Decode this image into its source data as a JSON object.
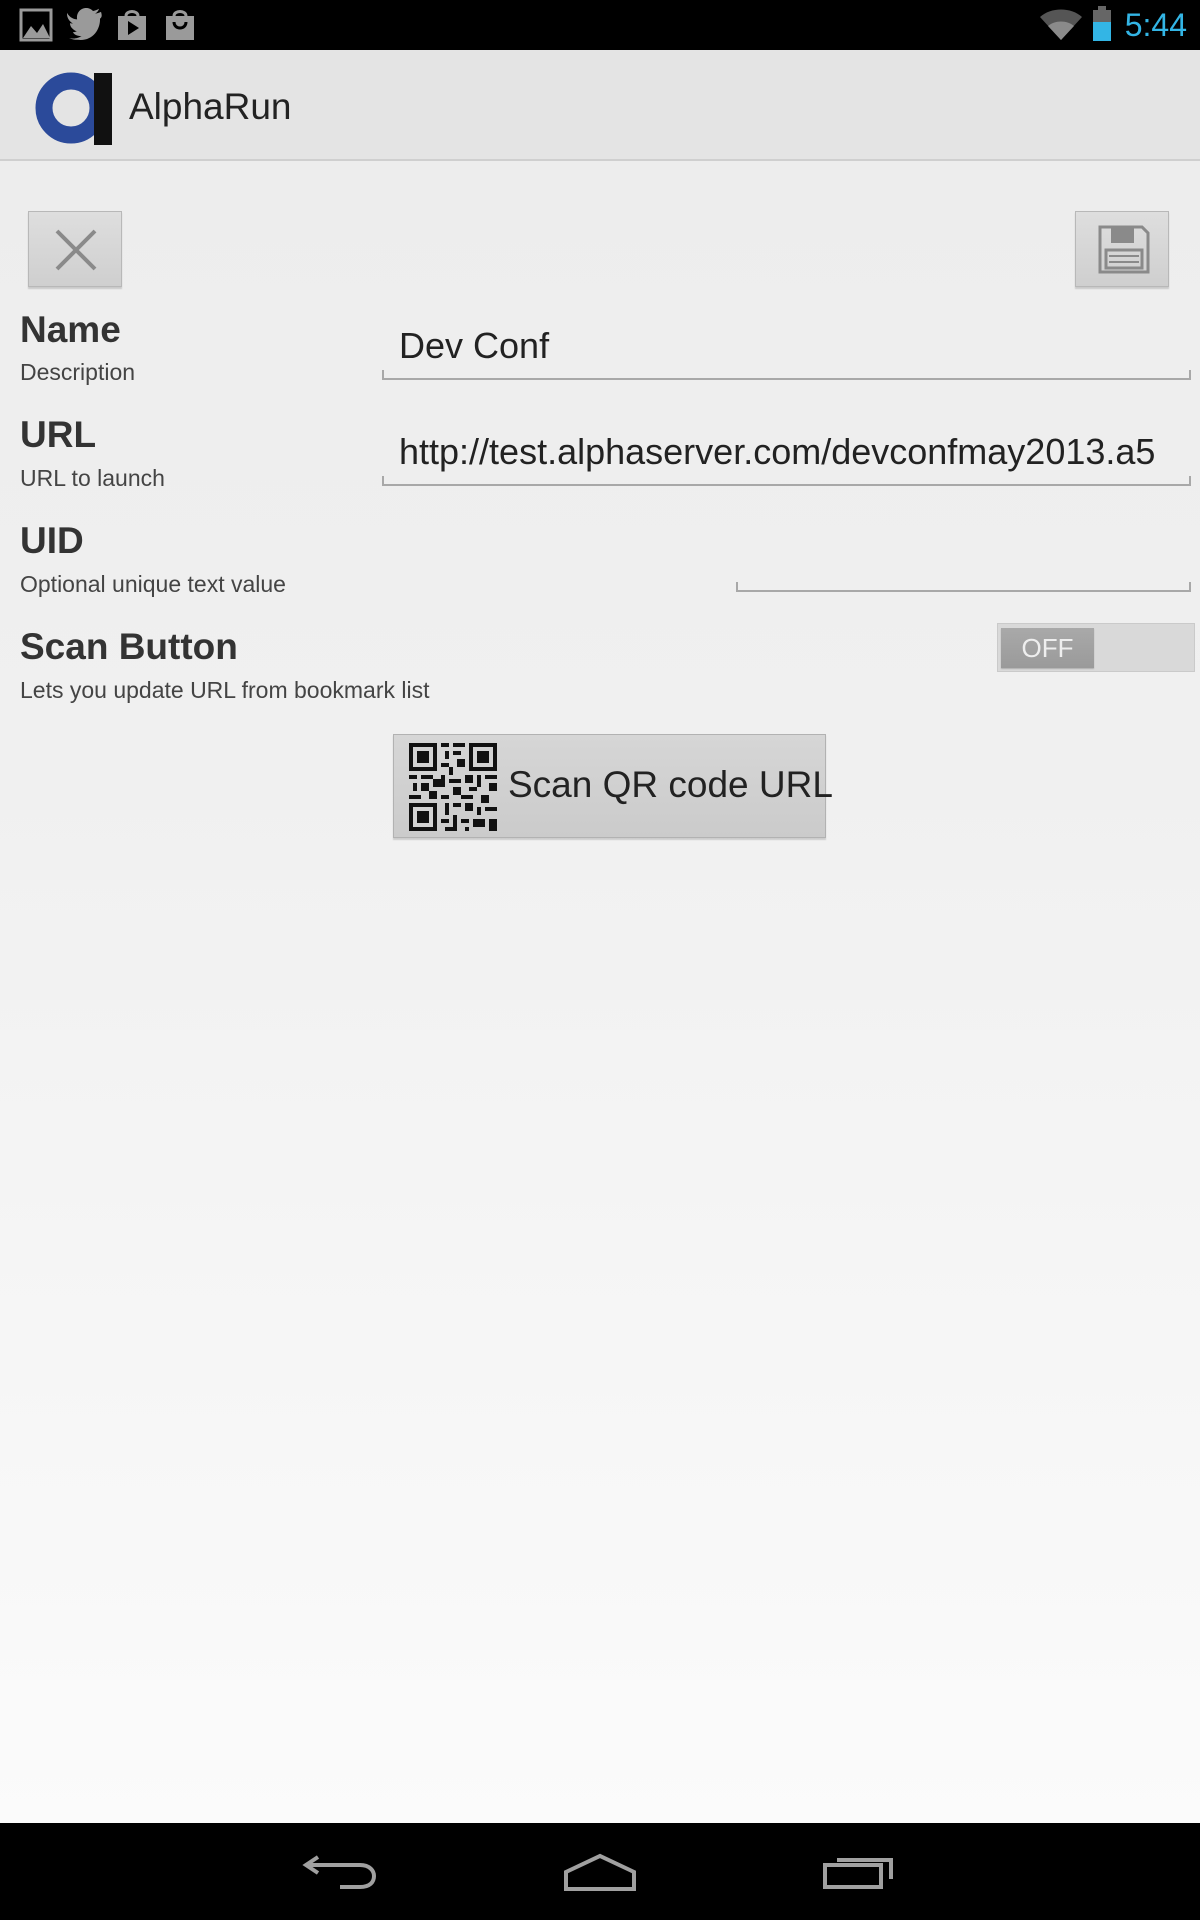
{
  "status_bar": {
    "time": "5:44",
    "notification_icons": [
      "gallery-icon",
      "twitter-icon",
      "play-store-icon",
      "shopping-bag-icon"
    ],
    "system_icons": [
      "wifi-icon",
      "battery-icon"
    ],
    "accent_color": "#33b5e5"
  },
  "action_bar": {
    "title": "AlphaRun",
    "logo_colors": [
      "#2b4a9a",
      "#111111"
    ]
  },
  "toolbar": {
    "close_icon": "close-icon",
    "save_icon": "save-icon"
  },
  "form": {
    "name": {
      "label": "Name",
      "description": "Description",
      "value": "Dev Conf"
    },
    "url": {
      "label": "URL",
      "description": "URL to launch",
      "value": "http://test.alphaserver.com/devconfmay2013.a5"
    },
    "uid": {
      "label": "UID",
      "description": "Optional unique text value",
      "value": ""
    },
    "scan_button_setting": {
      "label": "Scan Button",
      "description": "Lets you update URL from bookmark list",
      "toggle_state": "OFF"
    }
  },
  "scan_button": {
    "label": "Scan QR code URL",
    "icon": "qr-code-icon"
  },
  "nav_bar": {
    "icons": [
      "back-icon",
      "home-icon",
      "recent-apps-icon"
    ]
  }
}
